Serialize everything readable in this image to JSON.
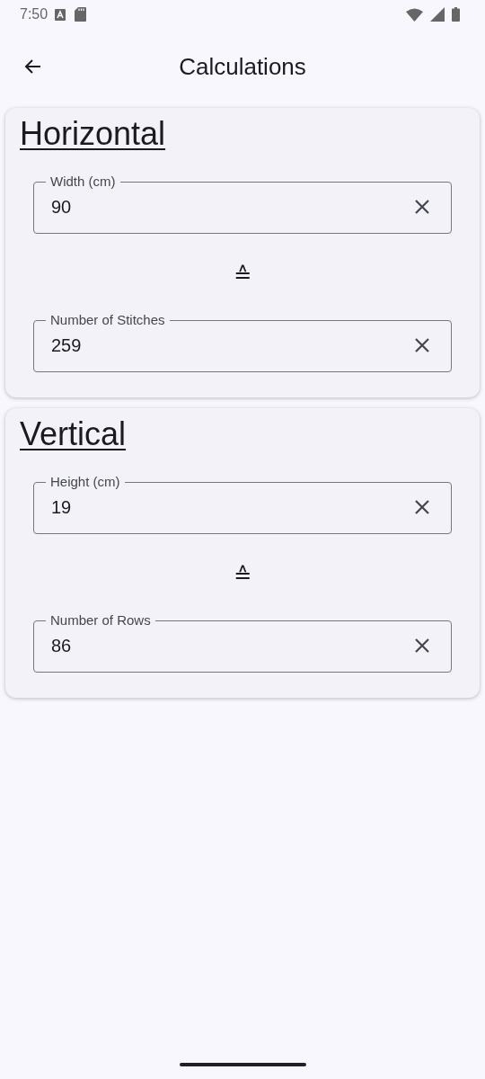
{
  "status_bar": {
    "time": "7:50"
  },
  "app_bar": {
    "title": "Calculations"
  },
  "sections": [
    {
      "title": "Horizontal",
      "fields": [
        {
          "label": "Width (cm)",
          "value": "90"
        },
        {
          "label": "Number of Stitches",
          "value": "259"
        }
      ],
      "symbol": "≙"
    },
    {
      "title": "Vertical",
      "fields": [
        {
          "label": "Height (cm)",
          "value": "19"
        },
        {
          "label": "Number of Rows",
          "value": "86"
        }
      ],
      "symbol": "≙"
    }
  ]
}
